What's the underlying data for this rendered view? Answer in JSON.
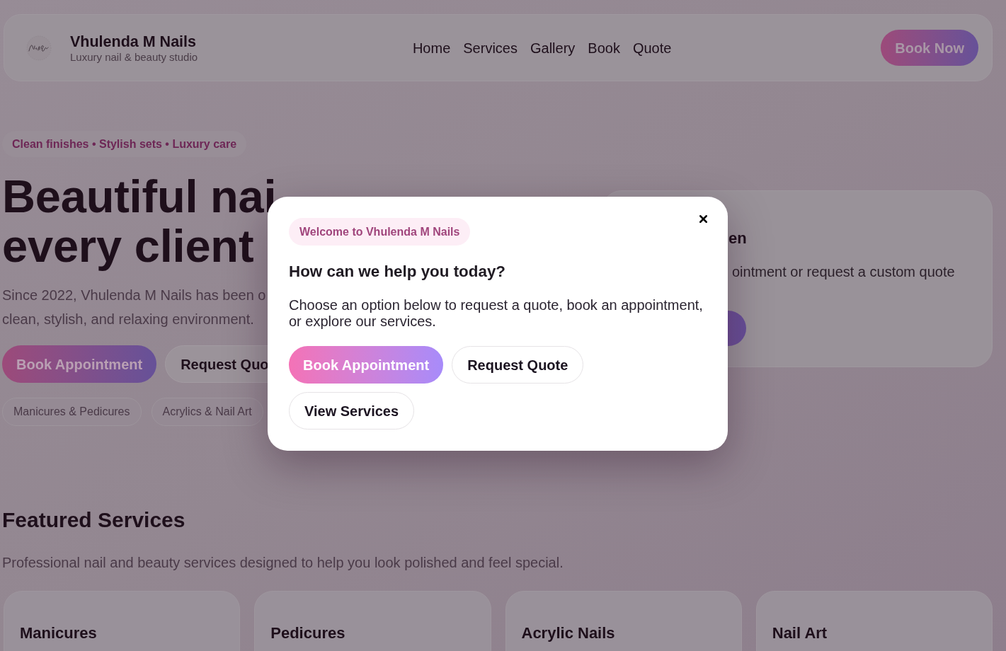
{
  "header": {
    "brand_name": "Vhulenda M Nails",
    "brand_tagline": "Luxury nail & beauty studio",
    "nav": [
      {
        "label": "Home"
      },
      {
        "label": "Services"
      },
      {
        "label": "Gallery"
      },
      {
        "label": "Book"
      },
      {
        "label": "Quote"
      }
    ],
    "cta": "Book Now"
  },
  "hero": {
    "tagline": "Clean finishes • Stylish sets • Luxury care",
    "heading_lines": [
      "Beautiful nai",
      "every client"
    ],
    "intro_lines": [
      "Since 2022, Vhulenda M Nails has been o",
      "clean, stylish, and relaxing environment."
    ],
    "buttons": [
      {
        "label": "Book Appointment",
        "kind": "primary"
      },
      {
        "label": "Request Quo",
        "kind": "secondary"
      }
    ],
    "chips": [
      "Manicures & Pedicures",
      "Acrylics & Nail Art"
    ]
  },
  "side_card": {
    "heading": "en",
    "text": "ointment or request a custom quote"
  },
  "featured": {
    "heading": "Featured Services",
    "subheading": "Professional nail and beauty services designed to help you look polished and feel special.",
    "cards": [
      {
        "title": "Manicures"
      },
      {
        "title": "Pedicures"
      },
      {
        "title": "Acrylic Nails"
      },
      {
        "title": "Nail Art"
      }
    ]
  },
  "modal": {
    "badge": "Welcome to Vhulenda M Nails",
    "title": "How can we help you today?",
    "text": "Choose an option below to request a quote, book an appointment, or explore our services.",
    "buttons": [
      {
        "label": "Book Appointment",
        "kind": "primary"
      },
      {
        "label": "Request Quote",
        "kind": "secondary"
      },
      {
        "label": "View Services",
        "kind": "secondary"
      }
    ]
  }
}
